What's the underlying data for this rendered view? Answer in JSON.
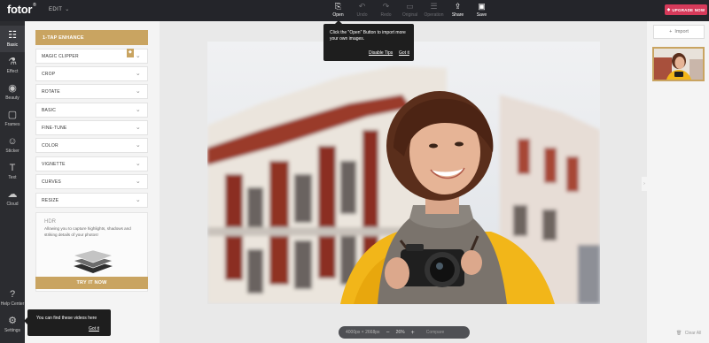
{
  "app": {
    "logo": "fotor",
    "logo_mark": "®",
    "mode": "EDIT"
  },
  "toolbar": {
    "items": [
      {
        "label": "Open",
        "icon": "open-icon",
        "enabled": true
      },
      {
        "label": "Undo",
        "icon": "undo-icon",
        "enabled": false
      },
      {
        "label": "Redo",
        "icon": "redo-icon",
        "enabled": false
      },
      {
        "label": "Original",
        "icon": "original-icon",
        "enabled": false
      },
      {
        "label": "Operation",
        "icon": "operation-icon",
        "enabled": false
      },
      {
        "label": "Share",
        "icon": "share-icon",
        "enabled": true
      },
      {
        "label": "Save",
        "icon": "save-icon",
        "enabled": true
      }
    ],
    "upgrade_label": "UPGRADE NOW"
  },
  "rail": {
    "items": [
      {
        "label": "Basic",
        "icon": "sliders-icon"
      },
      {
        "label": "Effect",
        "icon": "flask-icon"
      },
      {
        "label": "Beauty",
        "icon": "eye-icon"
      },
      {
        "label": "Frames",
        "icon": "frame-icon"
      },
      {
        "label": "Sticker",
        "icon": "sticker-icon"
      },
      {
        "label": "Text",
        "icon": "text-icon"
      },
      {
        "label": "Cloud",
        "icon": "cloud-icon"
      },
      {
        "label": "Help Center",
        "icon": "help-icon"
      },
      {
        "label": "Settings",
        "icon": "settings-icon"
      }
    ],
    "active": "Basic"
  },
  "panel": {
    "enhance_label": "1-TAP ENHANCE",
    "items": [
      "MAGIC CLIPPER",
      "CROP",
      "ROTATE",
      "BASIC",
      "FINE-TUNE",
      "COLOR",
      "VIGNETTE",
      "CURVES",
      "RESIZE"
    ],
    "hdr": {
      "title": "HDR",
      "description": "Allowing you to capture highlights, shadows and striking details of your photos!",
      "button": "TRY IT NOW"
    }
  },
  "canvas": {
    "dims": "4000px × 2668px",
    "zoom": "26%",
    "compare_label": "Compare"
  },
  "right_panel": {
    "import_label": "Import",
    "clear_label": "Clear All"
  },
  "tooltips": {
    "open": {
      "message": "Click the \"Open\" Button to import more your own images.",
      "disable": "Disable Tips",
      "gotit": "Got it"
    },
    "videos": {
      "message": "You can find these videos here",
      "gotit": "Got it"
    }
  },
  "colors": {
    "accent": "#c9a461",
    "topbar": "#24252a",
    "rail": "#2b2c30",
    "upgrade": "#d63a5a"
  }
}
